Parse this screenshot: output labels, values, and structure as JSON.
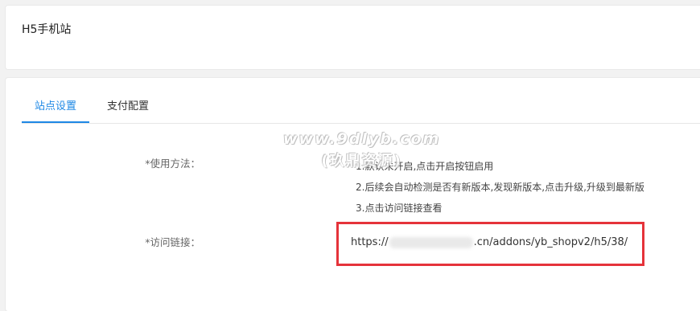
{
  "header": {
    "title": "H5手机站"
  },
  "tabs": [
    {
      "label": "站点设置",
      "active": true
    },
    {
      "label": "支付配置",
      "active": false
    }
  ],
  "form": {
    "usage_label": "*使用方法：",
    "instructions": [
      "1.默认未开启,点击开启按钮启用",
      "2.后续会自动检测是否有新版本,发现新版本,点击升级,升级到最新版",
      "3.点击访问链接查看"
    ],
    "link_label": "*访问链接：",
    "link_prefix": "https://",
    "link_suffix": ".cn/addons/yb_shopv2/h5/38/"
  },
  "watermark": {
    "url": "www.9dlyb.com",
    "sub": "(玖鼎资源)"
  },
  "colors": {
    "accent": "#1e88e5",
    "highlight_border": "#e5333a",
    "background": "#f2f2f2"
  }
}
